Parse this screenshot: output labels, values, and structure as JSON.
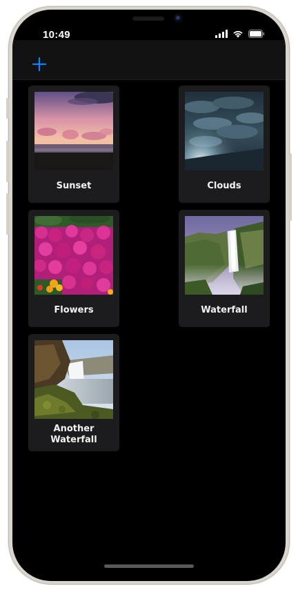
{
  "status_bar": {
    "time": "10:49",
    "icons": [
      "signal-icon",
      "wifi-icon",
      "battery-icon"
    ]
  },
  "nav_bar": {
    "add_icon": "plus-icon",
    "accent_color": "#0a84ff"
  },
  "items": [
    {
      "label": "Sunset",
      "image": "sunset-photo"
    },
    {
      "label": "Clouds",
      "image": "clouds-photo"
    },
    {
      "label": "Flowers",
      "image": "flowers-photo"
    },
    {
      "label": "Waterfall",
      "image": "waterfall-photo"
    },
    {
      "label": "Another Waterfall",
      "image": "another-waterfall-photo"
    }
  ],
  "colors": {
    "background": "#000000",
    "card": "#1c1c1e",
    "nav_bar": "#121212",
    "text": "#f2f2f2"
  }
}
